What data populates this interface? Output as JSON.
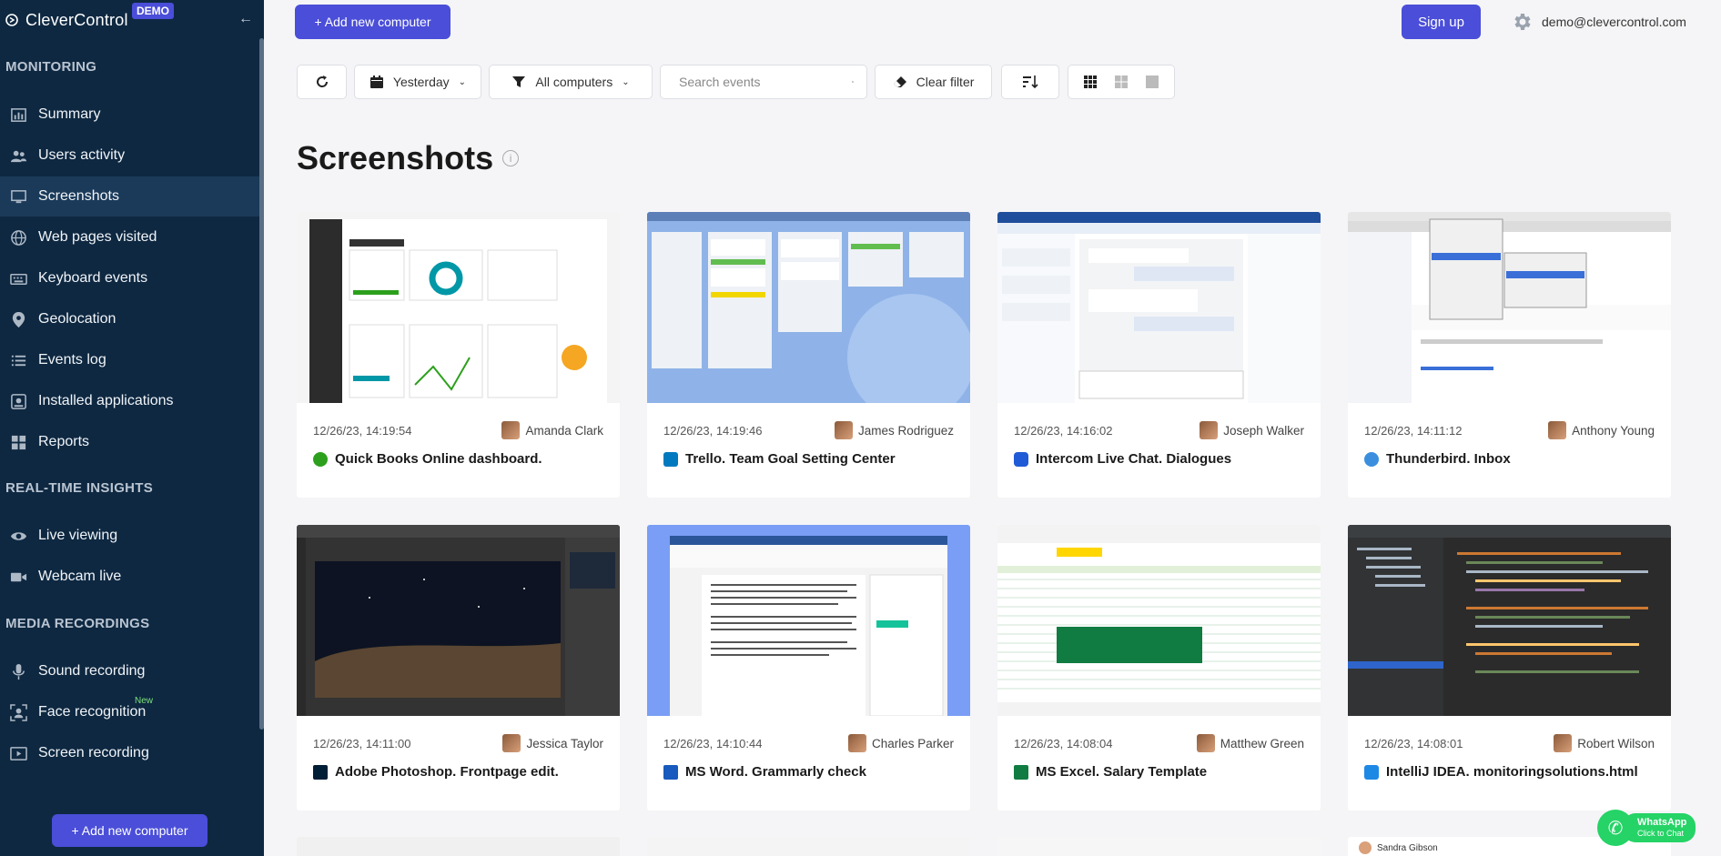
{
  "sidebar": {
    "brand": "CleverControl",
    "demo_badge": "DEMO",
    "sections": {
      "monitoring": "MONITORING",
      "realtime": "REAL-TIME INSIGHTS",
      "media": "MEDIA RECORDINGS"
    },
    "items": [
      {
        "label": "Summary",
        "icon": "chart-bar-icon"
      },
      {
        "label": "Users activity",
        "icon": "users-icon"
      },
      {
        "label": "Screenshots",
        "icon": "monitor-icon",
        "active": true
      },
      {
        "label": "Web pages visited",
        "icon": "globe-icon"
      },
      {
        "label": "Keyboard events",
        "icon": "keyboard-icon"
      },
      {
        "label": "Geolocation",
        "icon": "map-pin-icon"
      },
      {
        "label": "Events log",
        "icon": "list-icon"
      },
      {
        "label": "Installed applications",
        "icon": "app-install-icon"
      },
      {
        "label": "Reports",
        "icon": "grid-icon"
      },
      {
        "label": "Live viewing",
        "icon": "eye-icon"
      },
      {
        "label": "Webcam live",
        "icon": "video-camera-icon"
      },
      {
        "label": "Sound recording",
        "icon": "microphone-icon"
      },
      {
        "label": "Face recognition",
        "icon": "face-scan-icon",
        "badge": "New"
      },
      {
        "label": "Screen recording",
        "icon": "play-screen-icon"
      }
    ],
    "add_button": "+ Add new computer"
  },
  "header": {
    "add_button": "+ Add new computer",
    "signup": "Sign up",
    "user_email": "demo@clevercontrol.com"
  },
  "toolbar": {
    "date_filter": "Yesterday",
    "computer_filter": "All computers",
    "search_placeholder": "Search events",
    "clear_filter": "Clear filter"
  },
  "page": {
    "title": "Screenshots"
  },
  "cards": [
    {
      "time": "12/26/23, 14:19:54",
      "user": "Amanda Clark",
      "caption": "Quick Books Online dashboard.",
      "app_color": "#2ca01c"
    },
    {
      "time": "12/26/23, 14:19:46",
      "user": "James Rodriguez",
      "caption": "Trello. Team Goal Setting Center",
      "app_color": "#0079bf"
    },
    {
      "time": "12/26/23, 14:16:02",
      "user": "Joseph Walker",
      "caption": "Intercom Live Chat. Dialogues",
      "app_color": "#1f5bd6"
    },
    {
      "time": "12/26/23, 14:11:12",
      "user": "Anthony Young",
      "caption": "Thunderbird. Inbox",
      "app_color": "#3b8ede"
    },
    {
      "time": "12/26/23, 14:11:00",
      "user": "Jessica Taylor",
      "caption": "Adobe Photoshop. Frontpage edit.",
      "app_color": "#001e36"
    },
    {
      "time": "12/26/23, 14:10:44",
      "user": "Charles Parker",
      "caption": "MS Word. Grammarly check",
      "app_color": "#185abd"
    },
    {
      "time": "12/26/23, 14:08:04",
      "user": "Matthew Green",
      "caption": "MS Excel. Salary Template",
      "app_color": "#107c41"
    },
    {
      "time": "12/26/23, 14:08:01",
      "user": "Robert Wilson",
      "caption": "IntelliJ IDEA. monitoringsolutions.html",
      "app_color": "#1e88e5"
    }
  ],
  "partial_row": {
    "visible_name": "Sandra Gibson"
  },
  "whatsapp": {
    "title": "WhatsApp",
    "subtitle": "Click to Chat"
  }
}
